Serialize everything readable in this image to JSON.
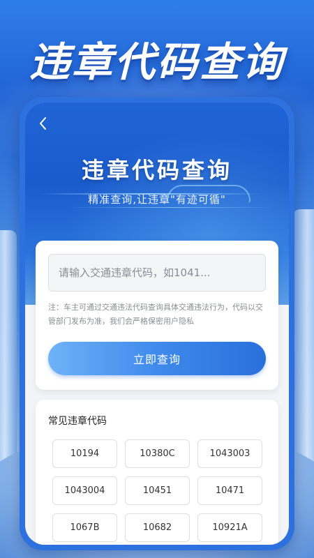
{
  "banner": {
    "title": "违章代码查询"
  },
  "screen": {
    "back_icon": "chevron-left-icon",
    "title": "违章代码查询",
    "subtitle": "精准查询,让违章\"有迹可循\""
  },
  "query": {
    "placeholder": "请输入交通违章代码，如1041...",
    "note": "注：车主可通过交通违法代码查询具体交通违法行为，代码以交管部门发布为准，我们会严格保密用户隐私",
    "button_label": "立即查询"
  },
  "codes": {
    "title": "常见违章代码",
    "items": [
      "10194",
      "10380C",
      "1043003",
      "1043004",
      "10451",
      "10471",
      "1067B",
      "10682",
      "10921A"
    ]
  },
  "colors": {
    "primary": "#2c71de",
    "button_gradient_start": "#6fb2f7",
    "button_gradient_end": "#2a70dc",
    "background": "#f2f4f8"
  }
}
